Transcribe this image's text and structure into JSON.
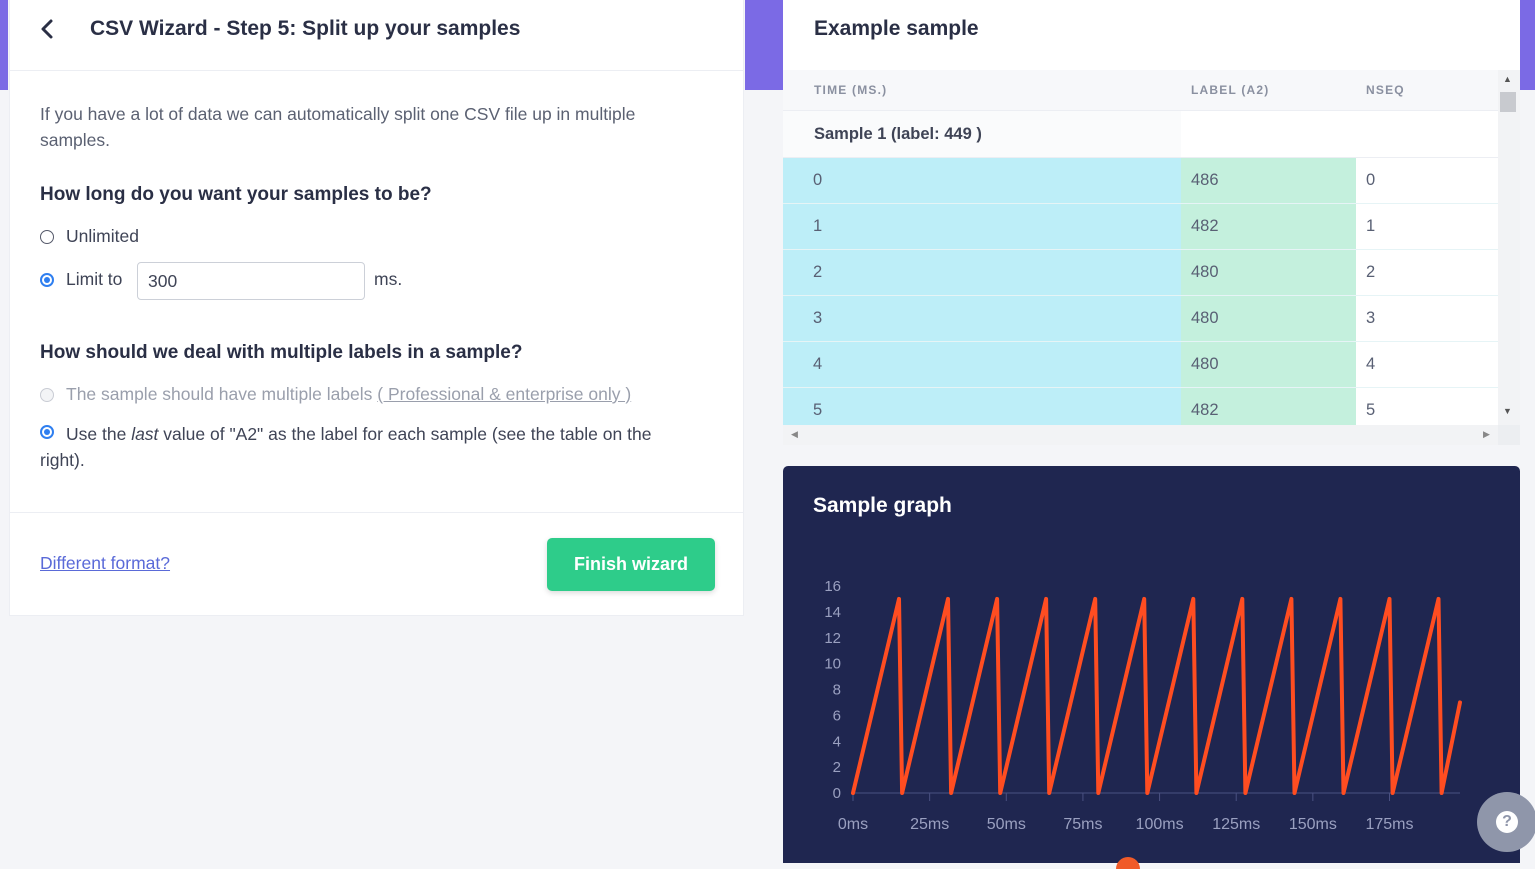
{
  "wizard": {
    "title": "CSV Wizard - Step 5: Split up your samples",
    "intro": "If you have a lot of data we can automatically split one CSV file up in multiple samples.",
    "length_question": "How long do you want your samples to be?",
    "option_unlimited": "Unlimited",
    "option_limit": "Limit to",
    "limit_value": "300",
    "limit_unit": "ms.",
    "label_question": "How should we deal with multiple labels in a sample?",
    "option_multi_labels": "The sample should have multiple labels",
    "option_multi_labels_link": "( Professional & enterprise only )",
    "option_last_pre": "Use the ",
    "option_last_em": "last",
    "option_last_post": " value of \"A2\" as the label for each sample (see the table on the right).",
    "different_format": "Different format?",
    "finish_button": "Finish wizard"
  },
  "example": {
    "title": "Example sample",
    "columns": [
      "TIME (MS.)",
      "LABEL (A2)",
      "NSEQ"
    ],
    "sample_label": "Sample 1 (label: 449 )",
    "rows": [
      [
        "0",
        "486",
        "0"
      ],
      [
        "1",
        "482",
        "1"
      ],
      [
        "2",
        "480",
        "2"
      ],
      [
        "3",
        "480",
        "3"
      ],
      [
        "4",
        "480",
        "4"
      ],
      [
        "5",
        "482",
        "5"
      ]
    ]
  },
  "graph": {
    "title": "Sample graph",
    "line_color": "#ff4d21",
    "background": "#1f2650",
    "help_icon": "question-icon"
  },
  "chart_data": {
    "type": "line",
    "title": "Sample graph",
    "xlabel": "",
    "ylabel": "",
    "y_ticks": [
      0,
      2,
      4,
      6,
      8,
      10,
      12,
      14,
      16
    ],
    "x_ticks": [
      "0ms",
      "25ms",
      "50ms",
      "75ms",
      "100ms",
      "125ms",
      "150ms",
      "175ms"
    ],
    "xlim": [
      0,
      198
    ],
    "ylim": [
      0,
      16
    ],
    "grid": false,
    "series": [
      {
        "x": [
          0,
          15,
          16,
          31,
          32,
          47,
          48,
          63,
          64,
          79,
          80,
          95,
          96,
          111,
          112,
          127,
          128,
          143,
          144,
          159,
          160,
          175,
          176,
          191,
          192,
          198
        ],
        "values": [
          0,
          15,
          0,
          15,
          0,
          15,
          0,
          15,
          0,
          15,
          0,
          15,
          0,
          15,
          0,
          15,
          0,
          15,
          0,
          15,
          0,
          15,
          0,
          15,
          0,
          7
        ]
      }
    ]
  }
}
